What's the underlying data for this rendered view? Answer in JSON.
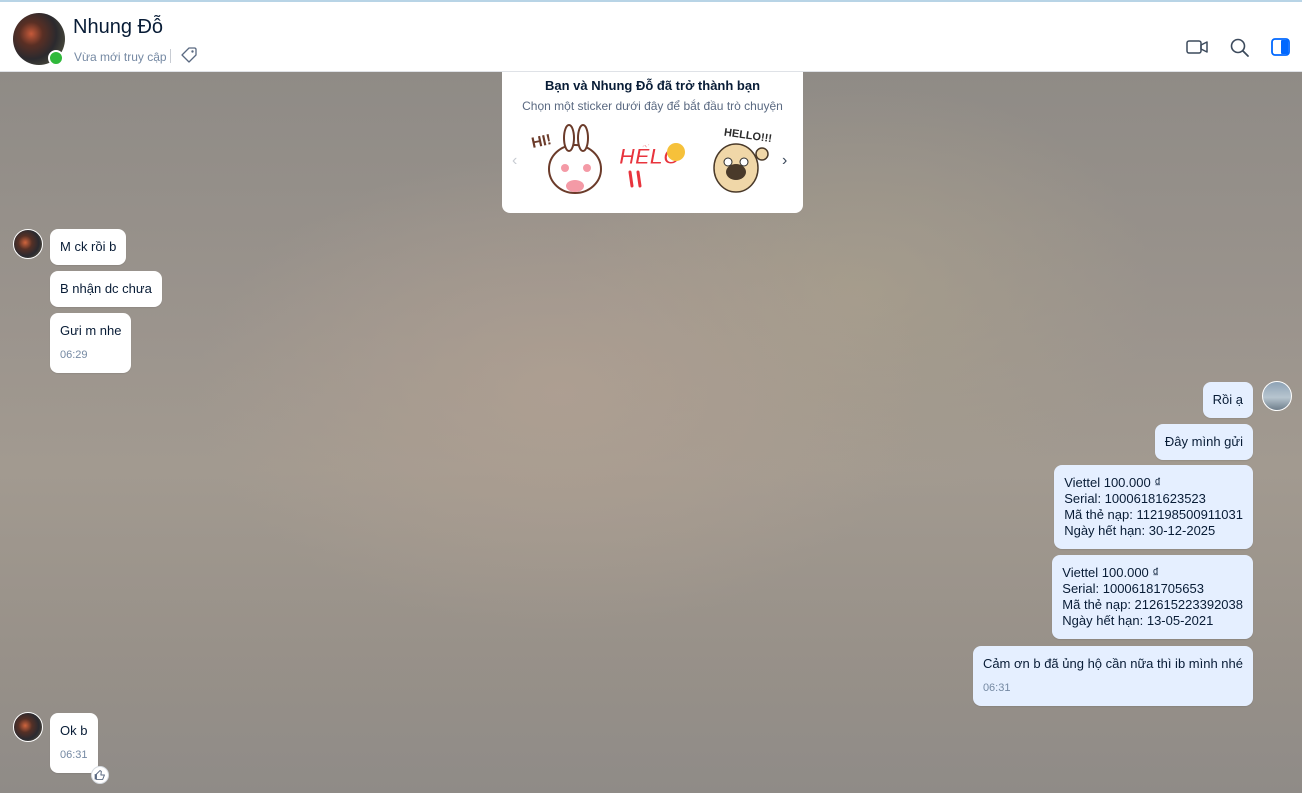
{
  "header": {
    "contact_name": "Nhung Đỗ",
    "presence": "Vừa mới truy cập",
    "accent_color": "#0068ff",
    "online_color": "#30b93b"
  },
  "friend_card": {
    "title": "Bạn và Nhung Đỗ đã trở thành bạn",
    "subtitle": "Chọn một sticker dưới đây để bắt đầu trò chuyện",
    "stickers": [
      {
        "icon": "bunny-hi-sticker",
        "text": "HI!"
      },
      {
        "icon": "hello-text-sticker",
        "text": "HẾLỎ"
      },
      {
        "icon": "pug-hello-sticker",
        "text": "HELLO!!!"
      }
    ]
  },
  "messages": {
    "m1": "M ck rồi b",
    "m2": "B nhận dc chưa",
    "m3": "Gưi m nhe",
    "m3_time": "06:29",
    "m4": "Rồi ạ",
    "m5": "Đây mình gửi",
    "m6": "Viettel 100.000 ₫\nSerial: 10006181623523\nMã thẻ nạp: 112198500911031\nNgày hết hạn: 30-12-2025",
    "m7": "Viettel 100.000 ₫\nSerial: 10006181705653\nMã thẻ nạp: 212615223392038\nNgày hết hạn: 13-05-2021",
    "m8": "Cảm ơn b đã ủng hộ cần nữa thì ib mình nhé",
    "m8_time": "06:31",
    "m9": "Ok b",
    "m9_time": "06:31"
  }
}
